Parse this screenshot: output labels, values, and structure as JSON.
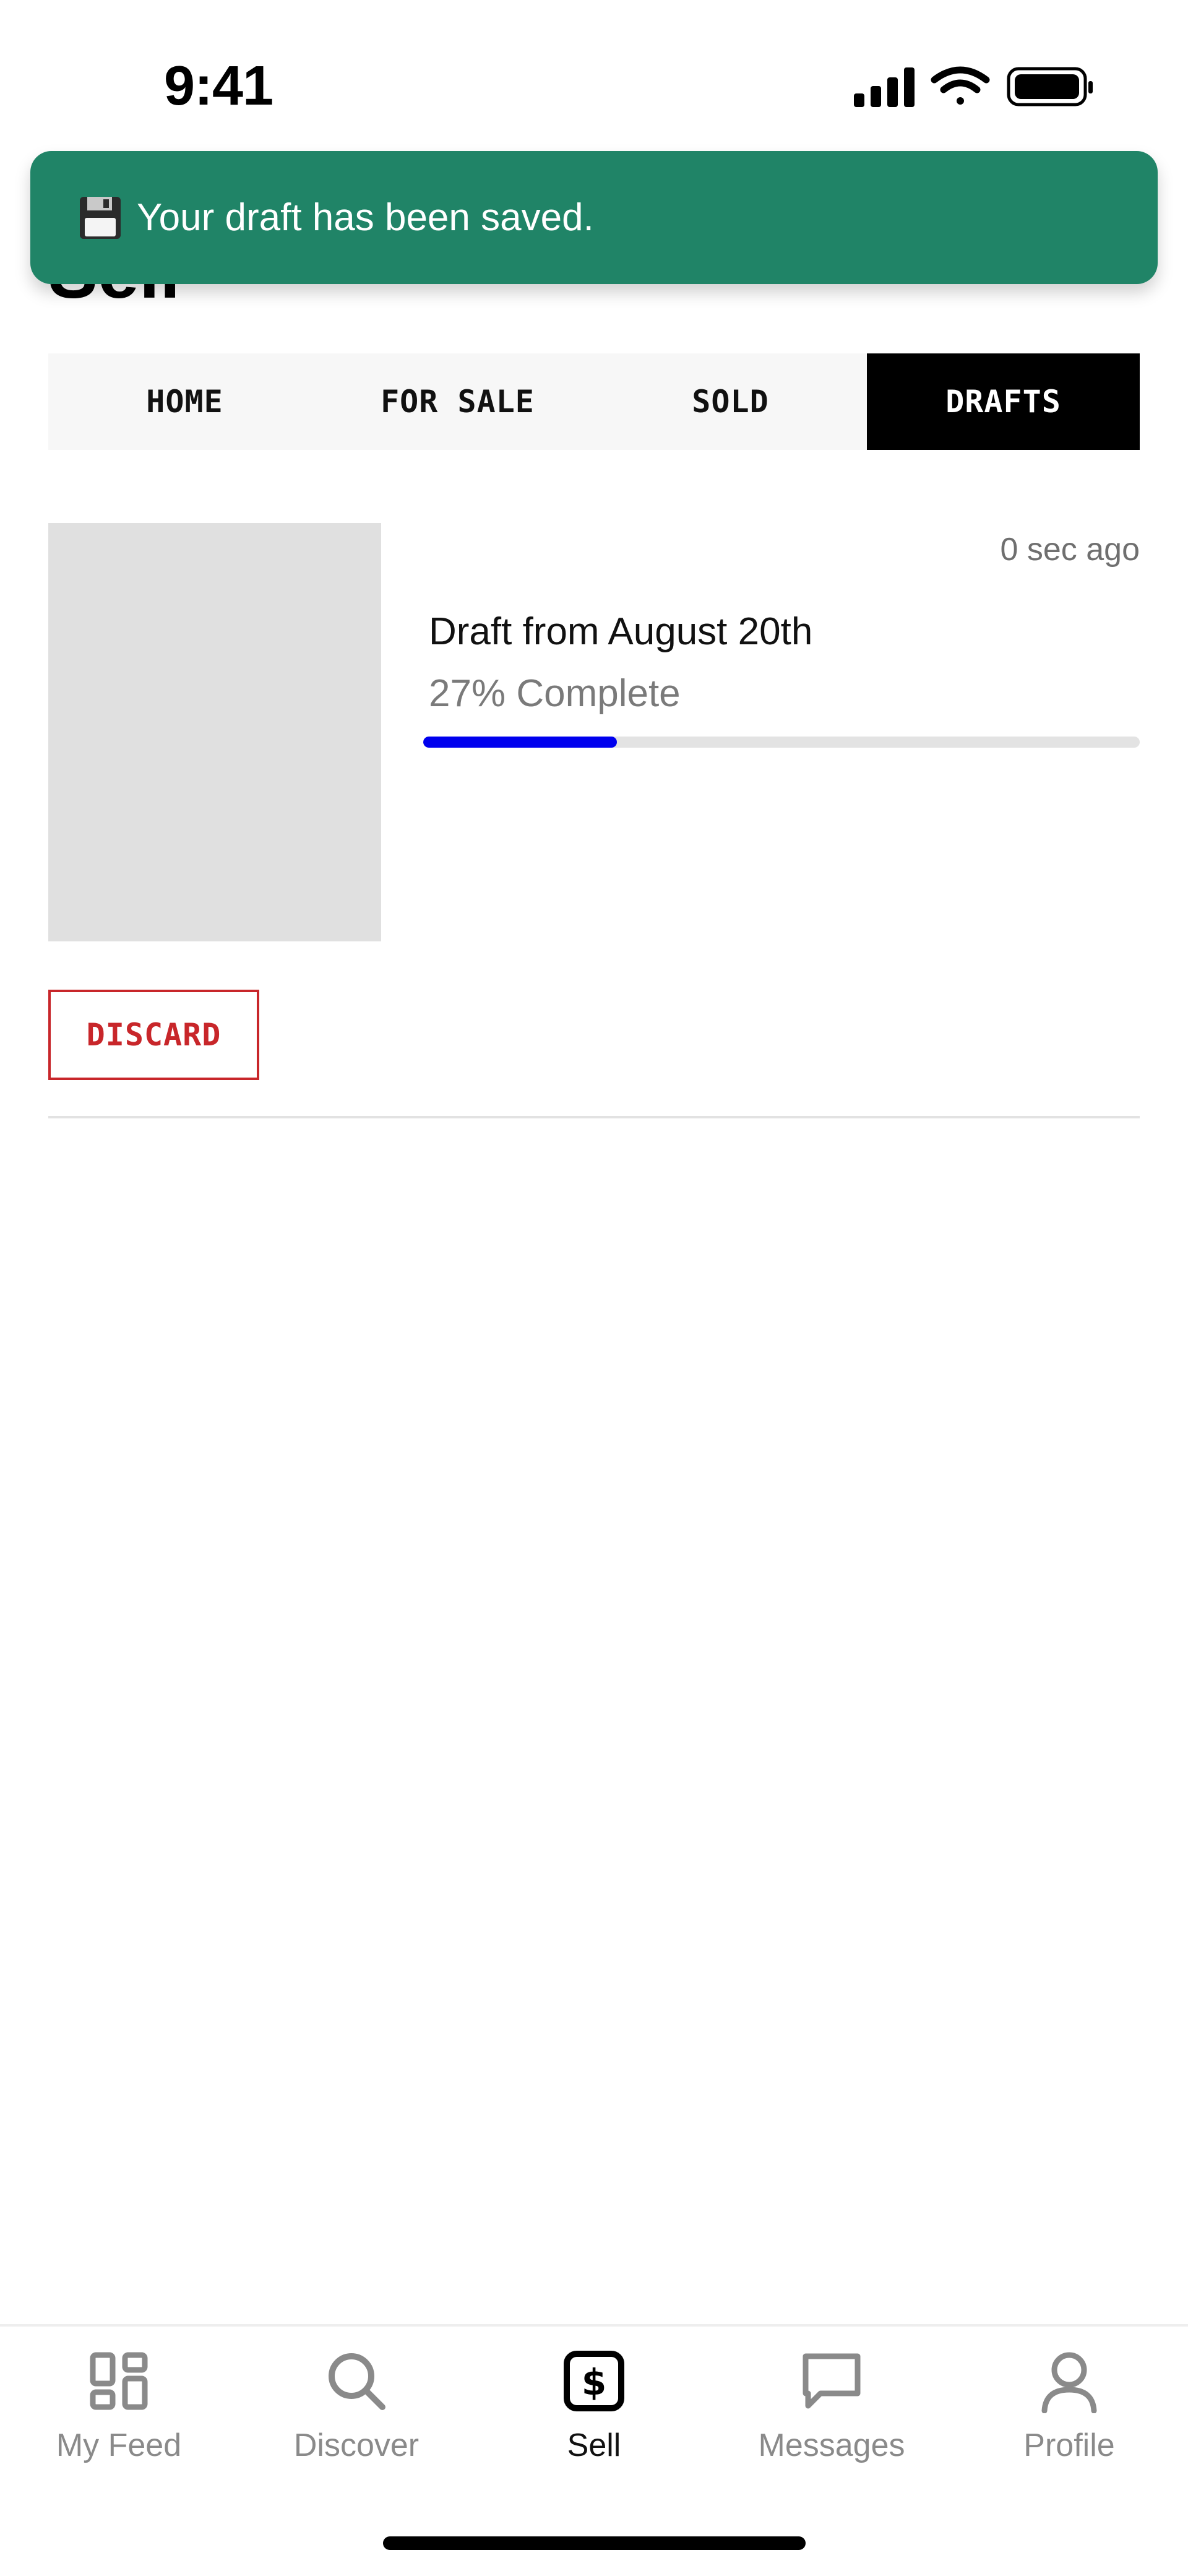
{
  "status_bar": {
    "time": "9:41"
  },
  "page": {
    "title": "Sell"
  },
  "toast": {
    "message": "Your draft has been saved.",
    "icon": "floppy-disk-icon",
    "background": "#208467"
  },
  "tabs": [
    {
      "label": "HOME",
      "active": false
    },
    {
      "label": "FOR SALE",
      "active": false
    },
    {
      "label": "SOLD",
      "active": false
    },
    {
      "label": "DRAFTS",
      "active": true
    }
  ],
  "draft": {
    "time_ago": "0 sec ago",
    "title": "Draft from August 20th",
    "progress_text": "27% Complete",
    "progress": 0.27,
    "progress_color": "#0000ee",
    "discard_label": "DISCARD",
    "discard_color": "#c8262a"
  },
  "bottom_nav": [
    {
      "label": "My Feed",
      "icon": "grid-icon",
      "active": false
    },
    {
      "label": "Discover",
      "icon": "search-icon",
      "active": false
    },
    {
      "label": "Sell",
      "icon": "dollar-sign-icon",
      "active": true
    },
    {
      "label": "Messages",
      "icon": "chat-bubble-icon",
      "active": false
    },
    {
      "label": "Profile",
      "icon": "person-icon",
      "active": false
    }
  ]
}
